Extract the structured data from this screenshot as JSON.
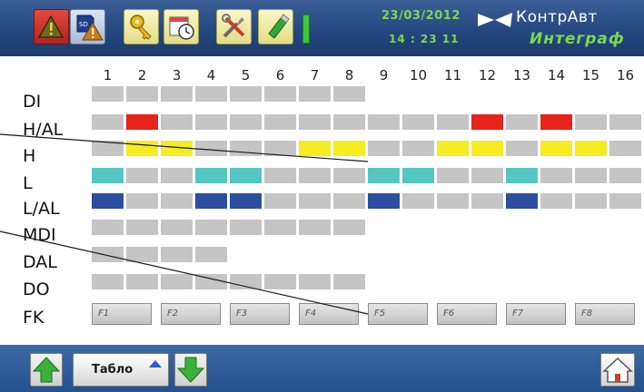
{
  "colors": {
    "off": "#c5c5c5",
    "red": "#e8231c",
    "yellow": "#f5ec22",
    "cyan": "#55c6c1",
    "blue": "#2b4ea1",
    "fk": "#d2d2d2"
  },
  "header": {
    "date": "23/03/2012",
    "time": "14 : 23   11",
    "brand_top": "КонтрАвт",
    "brand_bottom": "Интеграф",
    "toolbar_icons": [
      {
        "name": "alarm-warning-icon"
      },
      {
        "name": "sd-card-warning-icon"
      },
      {
        "name": "key-icon"
      },
      {
        "name": "calendar-clock-icon"
      },
      {
        "name": "tools-icon"
      },
      {
        "name": "usb-drive-icon"
      }
    ]
  },
  "columns": [
    "1",
    "2",
    "3",
    "4",
    "5",
    "6",
    "7",
    "8",
    "9",
    "10",
    "11",
    "12",
    "13",
    "14",
    "15",
    "16"
  ],
  "rows": [
    {
      "label": "DI",
      "cells": [
        "off",
        "off",
        "off",
        "off",
        "off",
        "off",
        "off",
        "off"
      ]
    },
    {
      "label": "H/AL",
      "cells": [
        "off",
        "red",
        "off",
        "off",
        "off",
        "off",
        "off",
        "off",
        "off",
        "off",
        "off",
        "red",
        "off",
        "red",
        "off",
        "off"
      ]
    },
    {
      "label": "H",
      "cells": [
        "off",
        "yellow",
        "yellow",
        "off",
        "off",
        "off",
        "yellow",
        "yellow",
        "off",
        "off",
        "yellow",
        "yellow",
        "off",
        "yellow",
        "yellow",
        "off"
      ]
    },
    {
      "label": "L",
      "cells": [
        "cyan",
        "off",
        "off",
        "cyan",
        "cyan",
        "off",
        "off",
        "off",
        "cyan",
        "cyan",
        "off",
        "off",
        "cyan",
        "off",
        "off",
        "off"
      ]
    },
    {
      "label": "L/AL",
      "cells": [
        "blue",
        "off",
        "off",
        "blue",
        "blue",
        "off",
        "off",
        "off",
        "blue",
        "off",
        "off",
        "off",
        "blue",
        "off",
        "off",
        "off"
      ]
    },
    {
      "label": "MDI",
      "cells": [
        "off",
        "off",
        "off",
        "off",
        "off",
        "off",
        "off",
        "off"
      ]
    },
    {
      "label": "DAL",
      "cells": [
        "off",
        "off",
        "off",
        "off"
      ]
    },
    {
      "label": "DO",
      "cells": [
        "off",
        "off",
        "off",
        "off",
        "off",
        "off",
        "off",
        "off"
      ]
    }
  ],
  "fk": {
    "label": "FK",
    "keys": [
      "F1",
      "F2",
      "F3",
      "F4",
      "F5",
      "F6",
      "F7",
      "F8"
    ]
  },
  "footer": {
    "tablo_label": "Табло",
    "up_icon": "arrow-up-icon",
    "down_icon": "arrow-down-icon",
    "home_icon": "home-icon"
  }
}
